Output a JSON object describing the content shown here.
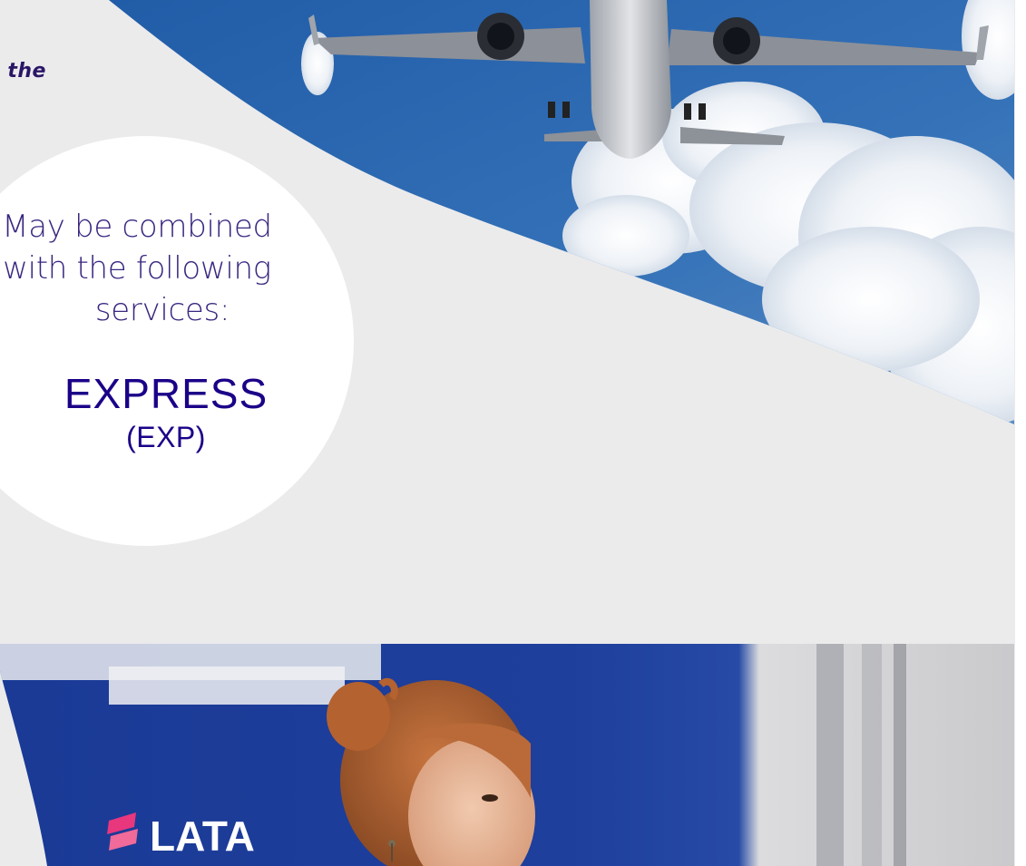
{
  "top_snippet": "n the",
  "services_intro": {
    "line1": "May be combined",
    "line2": "with the following",
    "line3": "services:"
  },
  "service": {
    "name": "EXPRESS",
    "code": "(EXP)"
  },
  "colors": {
    "brand_indigo": "#1b0088",
    "text_purple": "#3a2680",
    "page_bg": "#ebebec",
    "sky_blue": "#2f63a8",
    "counter_blue": "#1a3a96"
  },
  "images": {
    "top": "airplane-in-sky-photo",
    "bottom": "airline-staff-at-counter-photo",
    "logo_fragment_text": "LATA"
  }
}
